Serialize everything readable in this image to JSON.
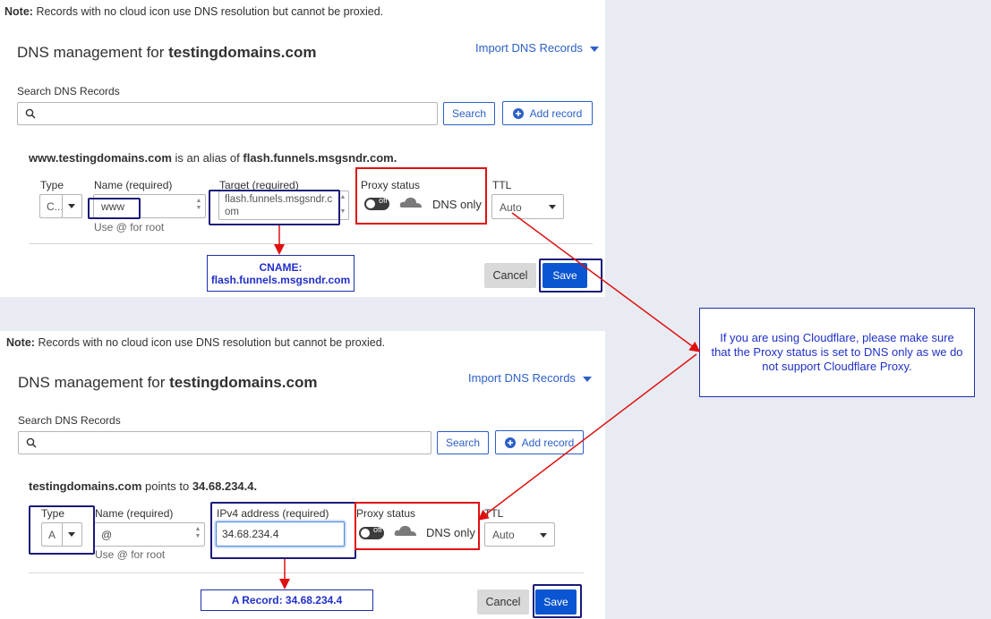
{
  "note_label": "Note:",
  "note_text": "Records with no cloud icon use DNS resolution but cannot be proxied.",
  "title_prefix": "DNS management for",
  "domain": "testingdomains.com",
  "import_label": "Import DNS Records",
  "search_label": "Search DNS Records",
  "search_button": "Search",
  "add_record_button": "Add record",
  "cancel_button": "Cancel",
  "save_button": "Save",
  "proxy_status_label": "Proxy status",
  "dns_only_label": "DNS only",
  "ttl_label": "TTL",
  "type_label": "Type",
  "name_label": "Name (required)",
  "use_root_hint": "Use @ for root",
  "toggle_off": "off",
  "top": {
    "alias_host": "www.testingdomains.com",
    "alias_mid": "is an alias of",
    "alias_target": "flash.funnels.msgsndr.com.",
    "type_value": "C...",
    "name_value": "www",
    "target_label": "Target (required)",
    "target_value_line1": "flash.funnels.msgsndr.c",
    "target_value_line2": "om",
    "ttl_value": "Auto",
    "callout_line1": "CNAME:",
    "callout_line2": "flash.funnels.msgsndr.com"
  },
  "bottom": {
    "points_host": "testingdomains.com",
    "points_mid": "points to",
    "points_ip": "34.68.234.4.",
    "type_value": "A",
    "name_value": "@",
    "ipv4_label": "IPv4 address (required)",
    "ipv4_value": "34.68.234.4",
    "ttl_value": "Auto",
    "callout_text": "A Record: 34.68.234.4"
  },
  "side_callout": "If you are using Cloudflare, please make sure that the Proxy status is set to DNS only as we do not support Cloudflare Proxy.",
  "colors": {
    "annotation_red": "#e01010",
    "annotation_navy": "#1a1a7a",
    "link_blue": "#2c60c7",
    "save_blue": "#0a55d1",
    "callout_text": "#2030c8"
  }
}
